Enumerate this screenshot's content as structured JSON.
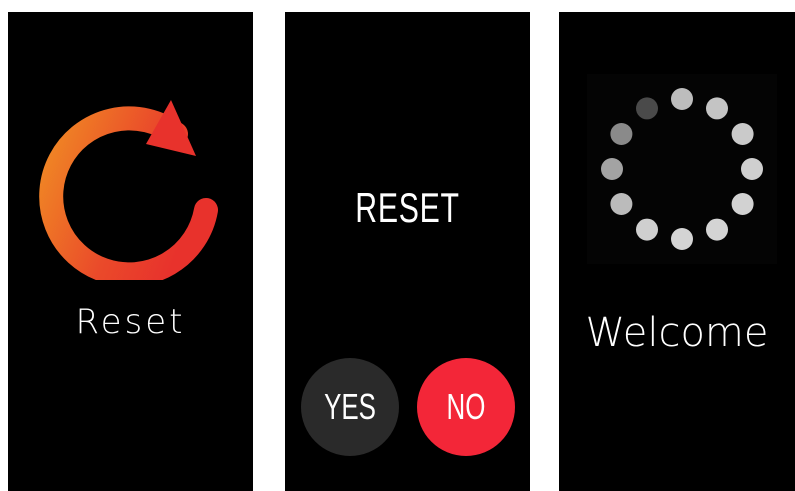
{
  "screen1": {
    "label": "Reset",
    "icon": "reset-arrow-icon",
    "gradient_start": "#f08a24",
    "gradient_end": "#e8322c"
  },
  "screen2": {
    "title": "RESET",
    "yes_label": "YES",
    "no_label": "NO",
    "yes_color": "#2a2a2a",
    "no_color": "#f32638"
  },
  "screen3": {
    "label": "Welcome",
    "icon": "loading-spinner-icon",
    "dot_count": 12
  }
}
